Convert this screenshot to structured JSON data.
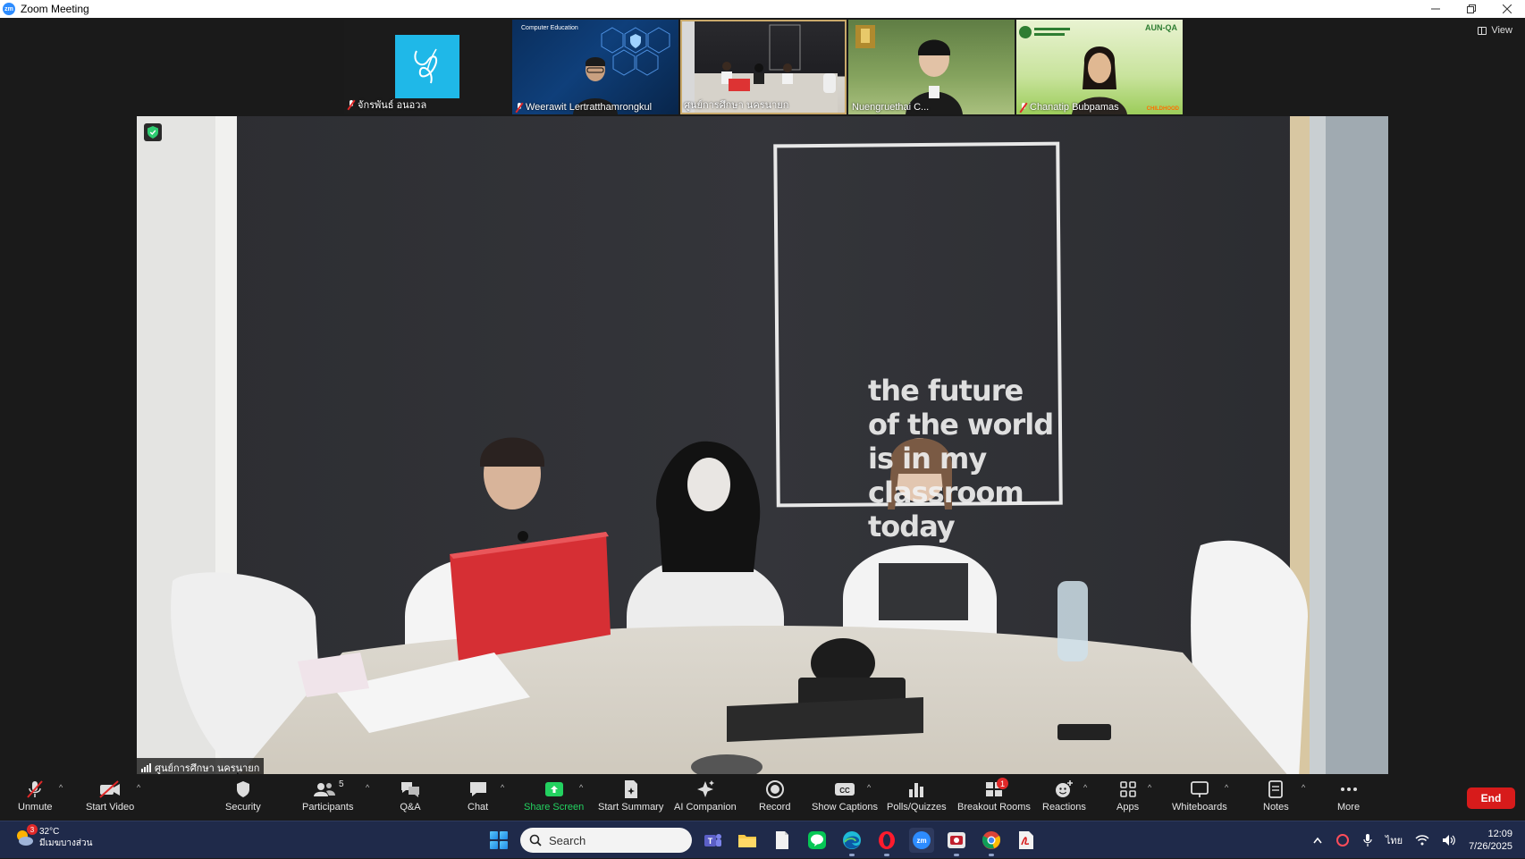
{
  "window": {
    "title": "Zoom Meeting",
    "app_icon_text": "zm",
    "controls": [
      "minimize",
      "restore",
      "close"
    ]
  },
  "view_button": {
    "label": "View"
  },
  "gallery": [
    {
      "name": "จักรพันธ์ อนอวล",
      "muted": true,
      "kind": "logo"
    },
    {
      "name": "Weerawit Lertratthamrongkul",
      "muted": true,
      "kind": "video",
      "overlay_text": "Computer Education"
    },
    {
      "name": "ศูนย์การศึกษา นครนายก",
      "muted": false,
      "kind": "video",
      "active": true
    },
    {
      "name": "Nuengruethai C...",
      "muted": false,
      "kind": "video"
    },
    {
      "name": "Chanatip Bubpamas",
      "muted": true,
      "kind": "video",
      "overlay_text": "AUN-QA",
      "overlay_text2": "CHILDHOOD"
    }
  ],
  "main_video": {
    "speaker_name": "ศูนย์การศึกษา นครนายก",
    "wall_text": [
      "the future",
      "of the world",
      "is in my",
      "classroom",
      "today"
    ]
  },
  "toolbar": {
    "unmute": "Unmute",
    "start_video": "Start Video",
    "security": "Security",
    "participants": "Participants",
    "participants_count": "5",
    "qa": "Q&A",
    "chat": "Chat",
    "share_screen": "Share Screen",
    "start_summary": "Start Summary",
    "ai_companion": "AI Companion",
    "record": "Record",
    "show_captions": "Show Captions",
    "polls": "Polls/Quizzes",
    "breakout_rooms": "Breakout Rooms",
    "breakout_badge": "1",
    "reactions": "Reactions",
    "apps": "Apps",
    "whiteboards": "Whiteboards",
    "notes": "Notes",
    "more": "More",
    "end": "End",
    "accent_green": "#23d160",
    "end_color": "#d71b1b"
  },
  "taskbar": {
    "weather_temp": "32°C",
    "weather_desc": "มีเมฆบางส่วน",
    "weather_badge": "3",
    "search_placeholder": "Search",
    "language": "ไทย",
    "time": "12:09",
    "date": "7/26/2025"
  }
}
